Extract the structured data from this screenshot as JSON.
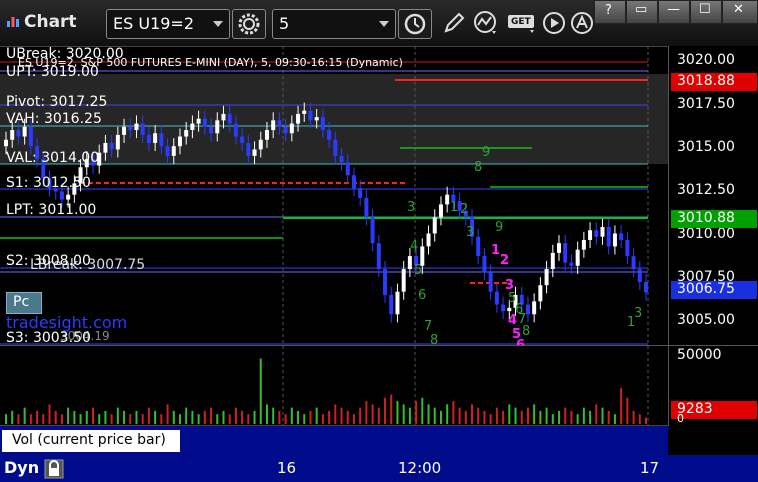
{
  "titlebar": {
    "app_title": "Chart",
    "symbol": "ES U19=2",
    "period": "5",
    "get_label": "GET",
    "win_controls": [
      "?",
      "▭",
      "—",
      "☐",
      "✕"
    ]
  },
  "chart": {
    "header": "ES U19=2, S&P 500 FUTURES E-MINI (DAY), 5, 09:30-16:15 (Dynamic)",
    "watermark": "tradesight.com",
    "pc_button": "Pc",
    "price_ticks": [
      "3020.00",
      "3017.50",
      "3015.00",
      "3012.50",
      "3010.00",
      "3007.50",
      "3005.00"
    ],
    "badges": [
      {
        "label": "3018.88",
        "color": "#e00000"
      },
      {
        "label": "3010.88",
        "color": "#00a000"
      },
      {
        "label": "3006.75",
        "color": "#1a30e0"
      }
    ],
    "levels": {
      "ubreak": "UBreak: 3020.00",
      "upt": "UPT: 3019.00",
      "pivot": "Pivot: 3017.25",
      "vah": "VAH: 3016.25",
      "val": "VAL: 3014.00",
      "s1": "S1: 3012.50",
      "lpt": "LPT: 3011.00",
      "s2": "S2: 3008.00",
      "lbreak": "LBreak: 3007.75",
      "s3": "S3: 3003.50",
      "ll": "3004.19"
    },
    "seq_labels_green": [
      "3",
      "4",
      "5",
      "6",
      "7",
      "8",
      "1",
      "2",
      "3",
      "8",
      "9",
      "5",
      "6",
      "7",
      "8",
      "9",
      "1",
      "3"
    ],
    "seq_labels_magenta": [
      "1",
      "2",
      "3",
      "4",
      "5",
      "6"
    ]
  },
  "chart_data": {
    "type": "candlestick",
    "title": "ES U19=2, S&P 500 FUTURES E-MINI (DAY), 5, 09:30-16:15 (Dynamic)",
    "ylim": [
      3003.5,
      3022.0
    ],
    "x_ticks": [
      "16",
      "12:00",
      "17"
    ],
    "last_price": 3006.75,
    "close": [
      3016.2,
      3016.8,
      3016.4,
      3017.0,
      3015.8,
      3015.0,
      3013.8,
      3013.2,
      3013.0,
      3012.5,
      3012.8,
      3013.5,
      3014.5,
      3015.0,
      3014.6,
      3015.4,
      3016.0,
      3015.6,
      3016.5,
      3017.0,
      3016.8,
      3017.2,
      3016.5,
      3016.0,
      3016.6,
      3015.8,
      3015.2,
      3015.8,
      3016.4,
      3016.8,
      3017.2,
      3017.5,
      3017.0,
      3016.6,
      3017.4,
      3017.8,
      3017.2,
      3016.4,
      3016.0,
      3015.2,
      3015.6,
      3016.2,
      3016.8,
      3017.4,
      3017.0,
      3016.6,
      3017.2,
      3017.8,
      3018.0,
      3017.4,
      3017.6,
      3016.8,
      3016.2,
      3015.2,
      3014.8,
      3014.0,
      3013.2,
      3012.6,
      3011.4,
      3009.8,
      3008.2,
      3006.6,
      3005.4,
      3006.8,
      3008.2,
      3009.0,
      3008.4,
      3009.6,
      3010.4,
      3011.4,
      3012.2,
      3012.8,
      3012.4,
      3011.8,
      3011.4,
      3010.2,
      3009.0,
      3008.0,
      3006.8,
      3006.0,
      3005.6,
      3005.8,
      3006.6,
      3006.0,
      3005.4,
      3006.2,
      3007.2,
      3008.2,
      3009.2,
      3009.8,
      3008.6,
      3008.4,
      3009.4,
      3010.0,
      3010.6,
      3010.2,
      3010.8,
      3009.6,
      3010.4,
      3010.0,
      3009.0,
      3008.2,
      3007.4,
      3006.75
    ],
    "volume": [
      3,
      4,
      3,
      5,
      3,
      4,
      3,
      6,
      4,
      3,
      5,
      4,
      3,
      4,
      5,
      3,
      4,
      3,
      5,
      4,
      3,
      4,
      3,
      5,
      4,
      3,
      6,
      4,
      3,
      5,
      4,
      3,
      4,
      5,
      3,
      4,
      3,
      5,
      4,
      3,
      4,
      20,
      6,
      5,
      4,
      3,
      5,
      4,
      3,
      4,
      5,
      3,
      4,
      6,
      5,
      4,
      3,
      5,
      7,
      6,
      5,
      8,
      9,
      7,
      6,
      5,
      7,
      8,
      6,
      5,
      4,
      6,
      7,
      5,
      4,
      6,
      5,
      4,
      3,
      5,
      4,
      6,
      5,
      4,
      5,
      6,
      4,
      5,
      3,
      4,
      5,
      4,
      3,
      5,
      4,
      6,
      5,
      4,
      3,
      11,
      8,
      4,
      3,
      2
    ],
    "volume_ticks": [
      "50000",
      "0"
    ],
    "volume_last": "9283"
  },
  "study": {
    "label": "Vol (current price bar)",
    "close": "×"
  },
  "timebar": {
    "dyn": "Dyn"
  }
}
